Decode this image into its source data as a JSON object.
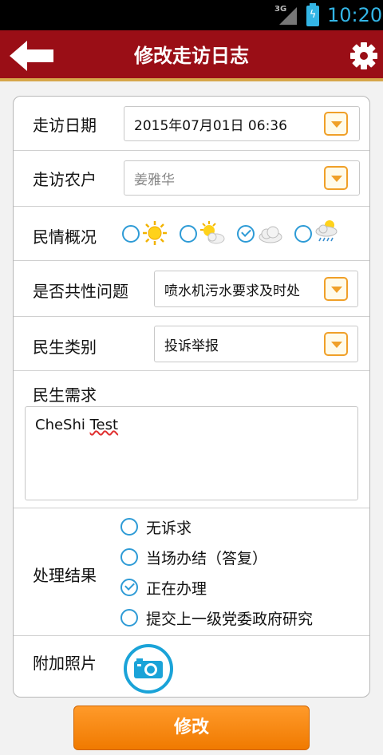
{
  "status_bar": {
    "network": "3G",
    "time": "10:20"
  },
  "header": {
    "title": "修改走访日志",
    "back_icon": "arrow-left-icon",
    "settings_icon": "gear-icon"
  },
  "form": {
    "visit_date": {
      "label": "走访日期",
      "value": "2015年07月01日 06:36"
    },
    "household": {
      "label": "走访农户",
      "value": "姜雅华"
    },
    "sentiment": {
      "label": "民情概况",
      "options": [
        {
          "icon": "sunny-icon",
          "checked": false
        },
        {
          "icon": "partly-cloudy-icon",
          "checked": false
        },
        {
          "icon": "cloudy-icon",
          "checked": true
        },
        {
          "icon": "rain-icon",
          "checked": false
        }
      ]
    },
    "common_issue": {
      "label": "是否共性问题",
      "value": "喷水机污水要求及时处"
    },
    "category": {
      "label": "民生类别",
      "value": "投诉举报"
    },
    "demand": {
      "label": "民生需求",
      "text_a": "CheShi",
      "text_b": "Test"
    },
    "result": {
      "label": "处理结果",
      "options": [
        {
          "label": "无诉求",
          "checked": false
        },
        {
          "label": "当场办结（答复）",
          "checked": false
        },
        {
          "label": "正在办理",
          "checked": true
        },
        {
          "label": "提交上一级党委政府研究",
          "checked": false
        }
      ]
    },
    "photo": {
      "label": "附加照片",
      "icon": "camera-icon"
    }
  },
  "submit": {
    "label": "修改"
  },
  "colors": {
    "header": "#9a0e16",
    "accent": "#2e9bd6",
    "button": "#f07a00"
  }
}
